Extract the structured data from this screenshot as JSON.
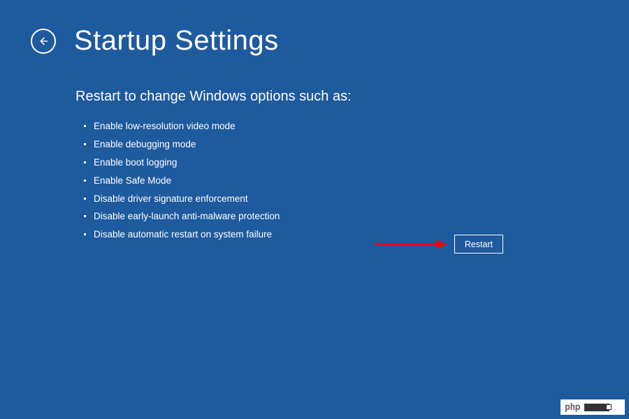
{
  "header": {
    "title": "Startup Settings"
  },
  "main": {
    "subtitle": "Restart to change Windows options such as:",
    "options": [
      "Enable low-resolution video mode",
      "Enable debugging mode",
      "Enable boot logging",
      "Enable Safe Mode",
      "Disable driver signature enforcement",
      "Disable early-launch anti-malware protection",
      "Disable automatic restart on system failure"
    ]
  },
  "actions": {
    "restart_label": "Restart"
  },
  "watermark": {
    "text": "php"
  },
  "colors": {
    "background": "#1e5a9e",
    "foreground": "#ffffff",
    "arrow": "#ff0000"
  }
}
